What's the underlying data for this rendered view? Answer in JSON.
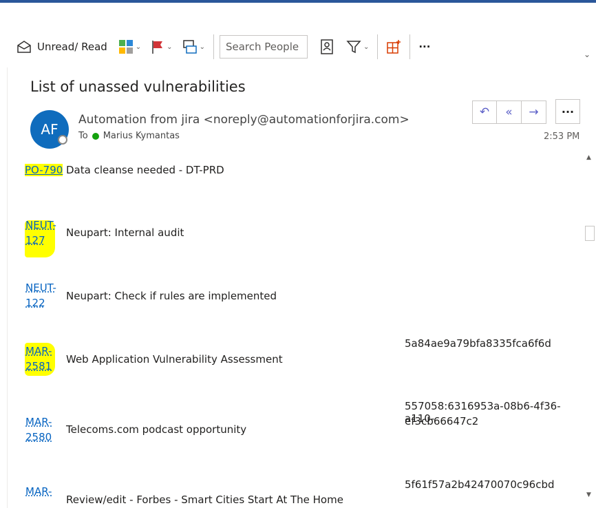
{
  "toolbar": {
    "unread_read": "Unread/ Read",
    "search_placeholder": "Search People",
    "more": "···"
  },
  "email": {
    "subject": "List of unassed vulnerabilities",
    "avatar_initials": "AF",
    "sender": "Automation from jira <noreply@automationforjira.com>",
    "to_label": "To",
    "recipient": "Marius Kymantas",
    "time": "2:53 PM"
  },
  "colors": {
    "accent": "#0f6cbd",
    "link": "#0563c1",
    "highlight": "#ffff00",
    "presence_ok": "#13a10e"
  },
  "issues": [
    {
      "key": "PO-790",
      "summary": "Data cleanse needed - DT-PRD",
      "account": ""
    },
    {
      "key_line1": "NEUT-",
      "key_line2": "127",
      "summary": "Neupart: Internal audit",
      "account": ""
    },
    {
      "key_line1": "NEUT-",
      "key_line2": "122",
      "summary": "Neupart: Check if rules are implemented",
      "account": ""
    },
    {
      "key_line1": "MAR-",
      "key_line2": "2581",
      "summary": "Web Application Vulnerability Assessment",
      "account": "5a84ae9a79bfa8335fca6f6d"
    },
    {
      "key_line1": "MAR-",
      "key_line2": "2580",
      "summary": "Telecoms.com podcast opportunity",
      "account_line1": "557058:6316953a-08b6-4f36-a110-",
      "account_line2": "ef3cb66647c2"
    },
    {
      "key_line1": "MAR-",
      "summary": "Review/edit - Forbes - Smart Cities Start At The Home",
      "account": "5f61f57a2b42470070c96cbd"
    }
  ]
}
